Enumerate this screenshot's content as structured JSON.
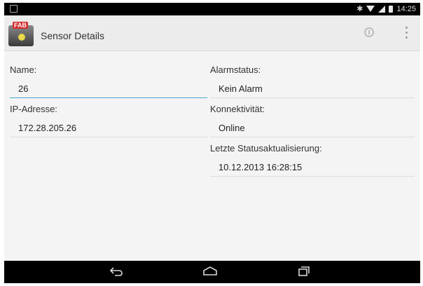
{
  "status_bar": {
    "time": "14:25"
  },
  "action_bar": {
    "app_icon_text": "FAB",
    "title": "Sensor Details"
  },
  "fields": {
    "name": {
      "label": "Name:",
      "value": "26"
    },
    "ip": {
      "label": "IP-Adresse:",
      "value": "172.28.205.26"
    },
    "alarm": {
      "label": "Alarmstatus:",
      "value": "Kein Alarm"
    },
    "connectivity": {
      "label": "Konnektivität:",
      "value": "Online"
    },
    "last_update": {
      "label": "Letzte Statusaktualisierung:",
      "value": "10.12.2013 16:28:15"
    }
  },
  "nav": {
    "back": "back-icon",
    "home": "home-icon",
    "recent": "recent-apps-icon"
  },
  "colors": {
    "focus_underline": "#4fa3cf",
    "status_bar": "#000000",
    "action_bar": "#ececec"
  }
}
